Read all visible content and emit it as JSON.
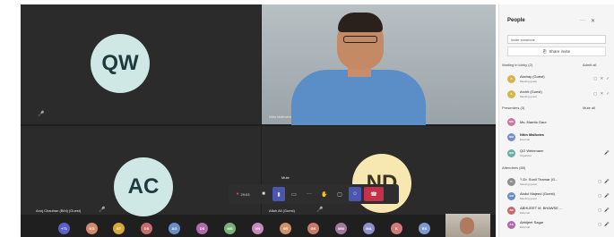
{
  "tiles": {
    "qw": {
      "initials": "QW",
      "label": ""
    },
    "video": {
      "label": "Nitin Malhotra"
    },
    "ac": {
      "initials": "AC",
      "label": "Anuj Chauhan (Bihi) (Guest)"
    },
    "nd": {
      "initials": "ND",
      "label": "Aflah Ali (Guest)"
    }
  },
  "controls": {
    "tooltip": "Mute",
    "timer": "29:03",
    "items": [
      {
        "icon": "record-icon",
        "glyph": "●"
      },
      {
        "icon": "camera-icon",
        "glyph": "■"
      },
      {
        "icon": "mic-icon",
        "glyph": "▮"
      },
      {
        "icon": "share-screen-icon",
        "glyph": "▭"
      },
      {
        "icon": "more-icon",
        "glyph": "···"
      },
      {
        "icon": "raise-hand-icon",
        "glyph": "✋"
      },
      {
        "icon": "chat-icon",
        "glyph": "▢"
      },
      {
        "icon": "people-icon",
        "glyph": "☺"
      },
      {
        "icon": "leave-call-icon",
        "glyph": "☎"
      }
    ]
  },
  "strip": {
    "avatars": [
      {
        "initials": "+71",
        "color": "#5b5fc7"
      },
      {
        "initials": "KG",
        "color": "#d28a6b"
      },
      {
        "initials": "ST",
        "color": "#d4a93a"
      },
      {
        "initials": "DS",
        "color": "#c76a6a"
      },
      {
        "initials": "AG",
        "color": "#6a8dc7"
      },
      {
        "initials": "DS",
        "color": "#b06aa7"
      },
      {
        "initials": "MS",
        "color": "#7ab07a"
      },
      {
        "initials": "VN",
        "color": "#c88ab8"
      },
      {
        "initials": "SR",
        "color": "#d0906a"
      },
      {
        "initials": "GK",
        "color": "#c77a6a"
      },
      {
        "initials": "MM",
        "color": "#a0789a"
      },
      {
        "initials": "MA",
        "color": "#8f8fd0"
      },
      {
        "initials": "K",
        "color": "#d07a7a"
      },
      {
        "initials": "RS",
        "color": "#7a9ad0"
      }
    ]
  },
  "panel": {
    "title": "People",
    "search_value": "invite someone",
    "share_label": "Share invite",
    "waiting": {
      "heading": "Waiting in lobby (2)",
      "action": "Admit all",
      "people": [
        {
          "initials": "A",
          "name": "Akshay (Guest)",
          "sub": "Meeting guest",
          "color": "#d8b54a"
        },
        {
          "initials": "A",
          "name": "Archit (Guest)",
          "sub": "Meeting guest",
          "color": "#d8b54a"
        }
      ]
    },
    "presenters": {
      "heading": "Presenters (3)",
      "action": "Mute all",
      "people": [
        {
          "initials": "MS",
          "name": "Ms. Mamta Gaur",
          "sub": "",
          "color": "#c77aa0",
          "bold": false
        },
        {
          "initials": "NM",
          "name": "Nitin Malhotra",
          "sub": "External",
          "color": "#7a8fc7",
          "bold": true
        },
        {
          "initials": "QW",
          "name": "QO Weinmann",
          "sub": "Organizer",
          "color": "#6ab0a7",
          "bold": false
        }
      ]
    },
    "attendees": {
      "heading": "Attendees (88)",
      "people": [
        {
          "initials": "D",
          "name": "?-Dr. Sunil Thamar (G...",
          "sub": "Meeting guest",
          "color": "#8f8f8f"
        },
        {
          "initials": "AM",
          "name": "Abdul Majeed (Guest)",
          "sub": "Meeting guest",
          "color": "#6a8dc7"
        },
        {
          "initials": "AB",
          "name": "ABHIJEET M. BHAWSE ...",
          "sub": "External",
          "color": "#c76a6a"
        },
        {
          "initials": "AS",
          "name": "Abhijeet Sagar",
          "sub": "External",
          "color": "#b06aa7"
        }
      ]
    }
  }
}
